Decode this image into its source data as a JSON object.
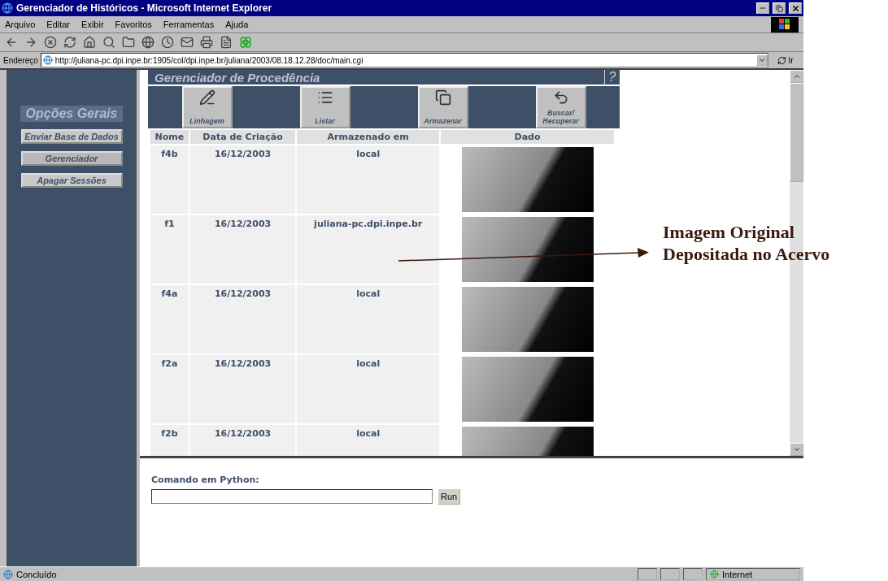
{
  "window": {
    "title": "Gerenciador de Históricos - Microsoft Internet Explorer"
  },
  "menu": [
    {
      "label": "Arquivo"
    },
    {
      "label": "Editar"
    },
    {
      "label": "Exibir"
    },
    {
      "label": "Favoritos"
    },
    {
      "label": "Ferramentas"
    },
    {
      "label": "Ajuda"
    }
  ],
  "address": {
    "label": "Endereço",
    "value": "http://juliana-pc.dpi.inpe.br:1905/col/dpi.inpe.br/juliana/2003/08.18.12.28/doc/main.cgi",
    "go": "Ir"
  },
  "sidebar": {
    "title": "Opções Gerais",
    "items": [
      {
        "label": "Enviar Base de Dados",
        "selected": false
      },
      {
        "label": "Gerenciador",
        "selected": true
      },
      {
        "label": "Apagar Sessões",
        "selected": false
      }
    ]
  },
  "panel": {
    "title": "Gerenciador de Procedência",
    "help": "?",
    "actions": [
      {
        "label": "Linhagem"
      },
      {
        "label": "Listar"
      },
      {
        "label": "Armazenar"
      },
      {
        "label": "Buscar/ Recuperar"
      }
    ]
  },
  "table": {
    "columns": [
      "Nome",
      "Data de Criação",
      "Armazenado em",
      "Dado"
    ],
    "rows": [
      {
        "name": "f4b",
        "date": "16/12/2003",
        "stored": "local"
      },
      {
        "name": "f1",
        "date": "16/12/2003",
        "stored": "juliana-pc.dpi.inpe.br"
      },
      {
        "name": "f4a",
        "date": "16/12/2003",
        "stored": "local"
      },
      {
        "name": "f2a",
        "date": "16/12/2003",
        "stored": "local"
      },
      {
        "name": "f2b",
        "date": "16/12/2003",
        "stored": "local"
      }
    ]
  },
  "python": {
    "label": "Comando em Python:",
    "button": "Run"
  },
  "status_bar": {
    "text": "Concluído",
    "zone": "Internet"
  },
  "annotation": {
    "lines": [
      "Imagem Original",
      "Depositada no Acervo"
    ]
  }
}
